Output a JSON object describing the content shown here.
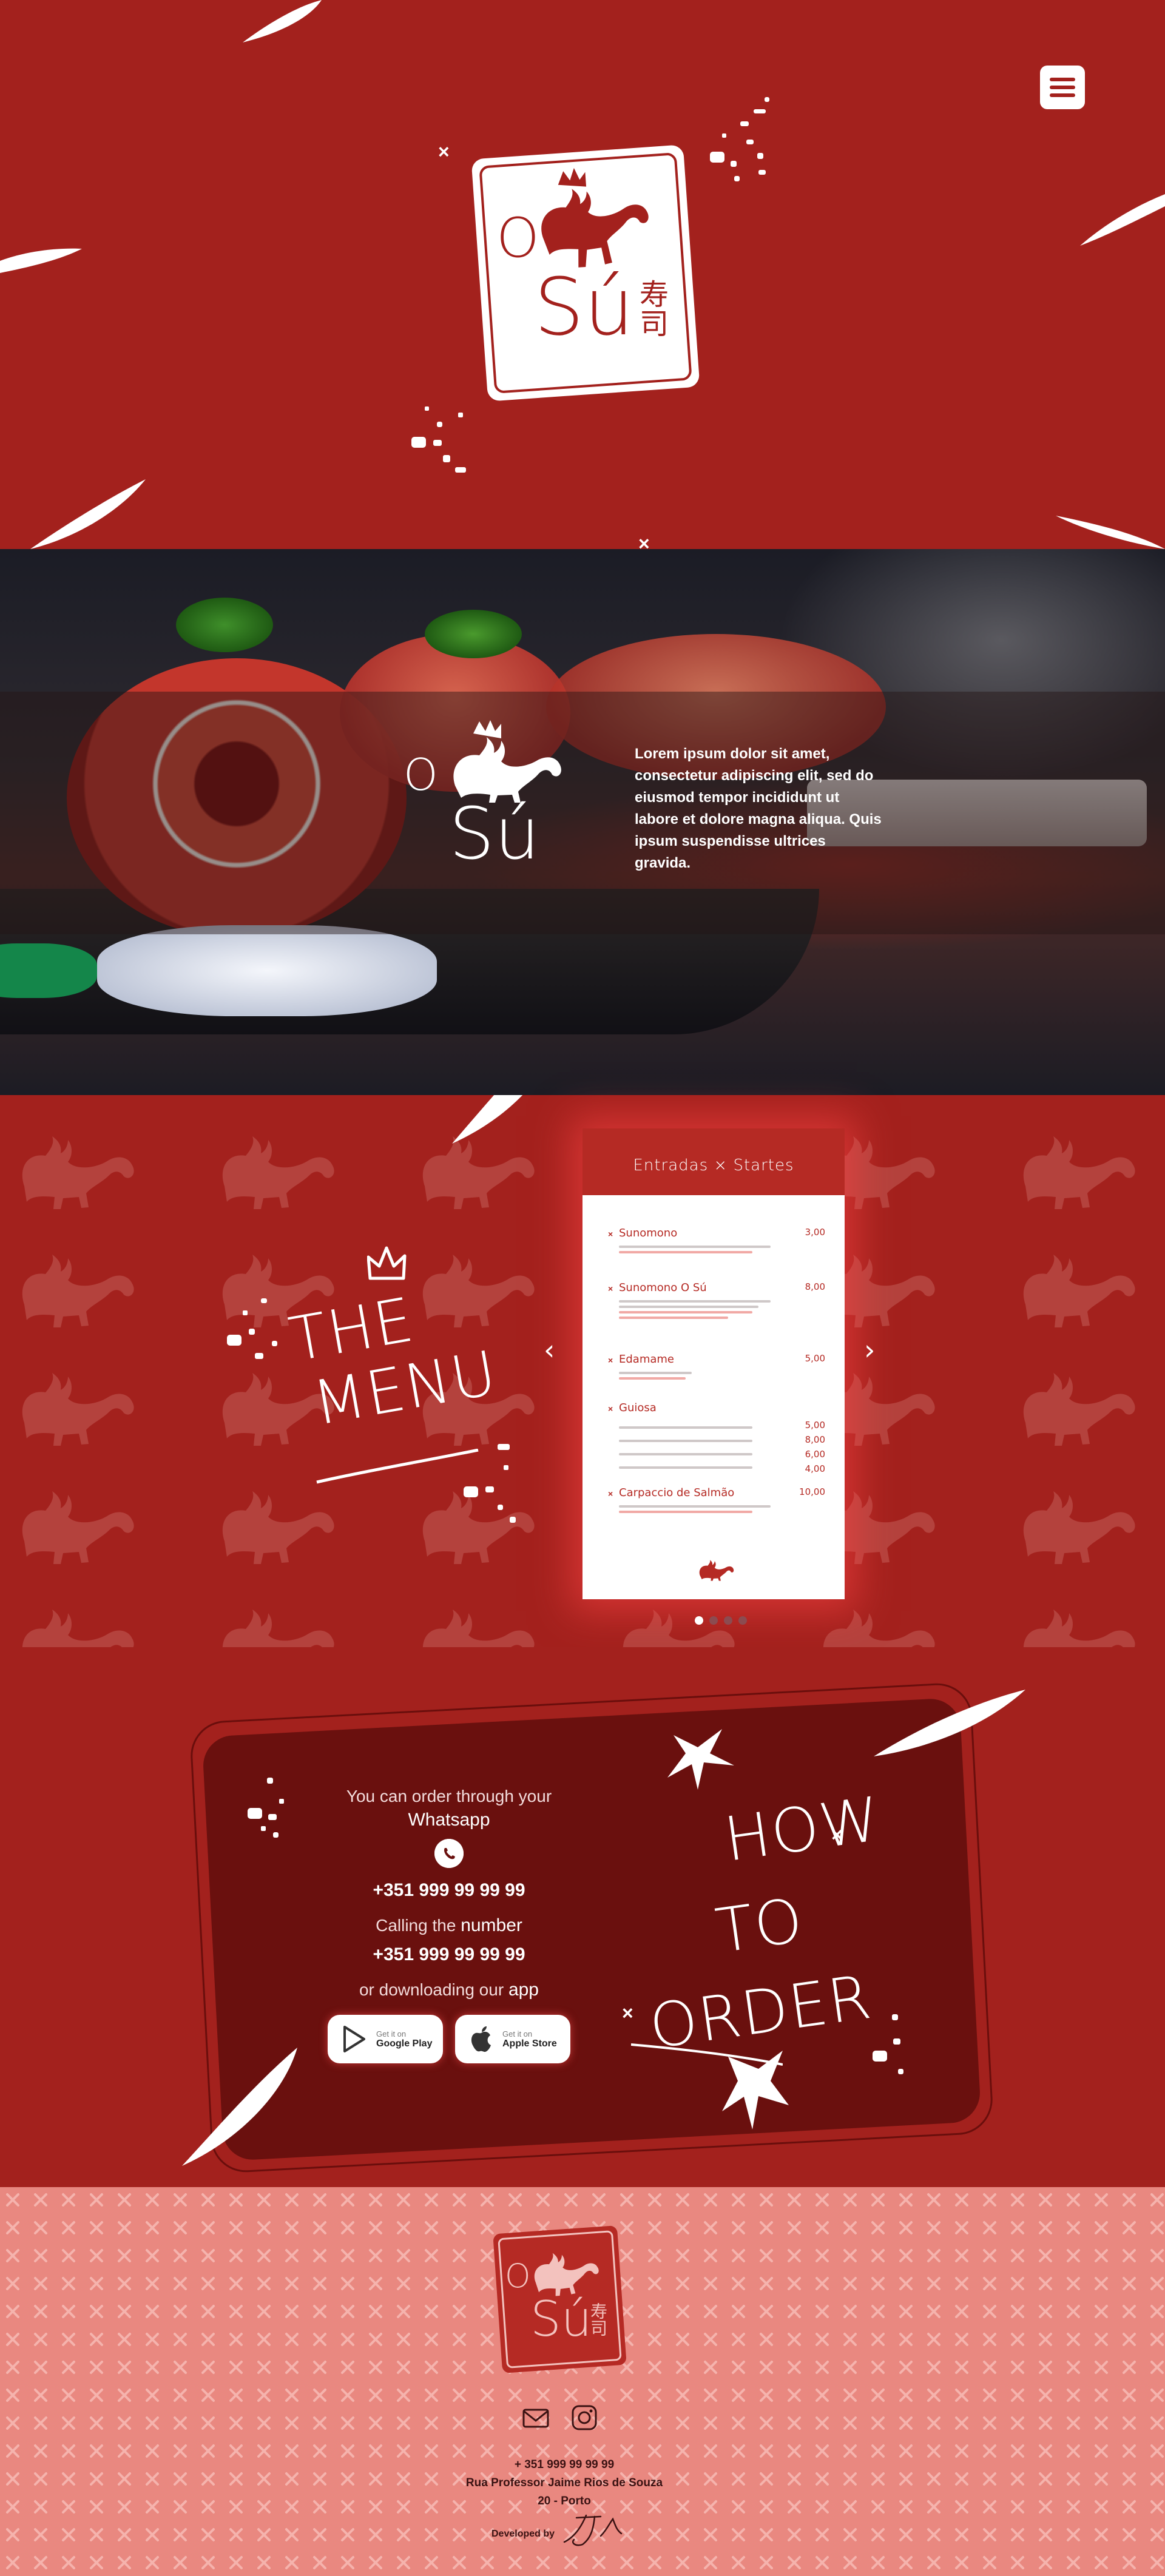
{
  "brand": {
    "logo_text_o": "O",
    "logo_text_su": "Sú",
    "logo_kanji": "寿司"
  },
  "hero": {
    "menu_icon": "hamburger-menu-icon"
  },
  "intro": {
    "text": "Lorem ipsum dolor sit amet, consectetur adipiscing elit, sed do eiusmod tempor incididunt ut labore et dolore magna aliqua. Quis ipsum suspendisse ultrices gravida."
  },
  "menu": {
    "heading_line1": "THE",
    "heading_line2": "MENU",
    "card_title": "Entradas × Startes",
    "items": [
      {
        "name": "Sunomono",
        "price": "3,00"
      },
      {
        "name": "Sunomono O Sú",
        "price": "8,00"
      },
      {
        "name": "Edamame",
        "price": "5,00"
      },
      {
        "name": "Guiosa",
        "price": "5,00"
      },
      {
        "name": "Carpaccio de Salmão",
        "price": "10,00"
      }
    ],
    "guiosa_prices": [
      "5,00",
      "8,00",
      "6,00",
      "4,00"
    ],
    "prev_icon": "chevron-left-icon",
    "next_icon": "chevron-right-icon",
    "slides": 4,
    "active_slide": 1
  },
  "order": {
    "line1": "You can order  through your",
    "whatsapp_label": "Whatsapp",
    "phone1": "+351 999 99 99 99",
    "calling_prefix": "Calling the",
    "calling_word": "number",
    "phone2": "+351 999 99 99 99",
    "download_prefix": "or downloading our",
    "download_word": "app",
    "google_small": "Get it on",
    "google_big": "Google Play",
    "apple_small": "Get it on",
    "apple_big": "Apple Store",
    "heading": [
      "HOW",
      "TO",
      "ORDER"
    ]
  },
  "footer": {
    "phone": "+ 351 999 99 99 99",
    "address1": "Rua Professor Jaime Rios de Souza",
    "address2": "20 - Porto",
    "developed_by": "Developed by",
    "mail_icon": "mail-icon",
    "instagram_icon": "instagram-icon"
  },
  "colors": {
    "primary_red": "#a3211d",
    "dark_red": "#6a100e",
    "footer_pink": "#e98880",
    "white": "#ffffff"
  }
}
